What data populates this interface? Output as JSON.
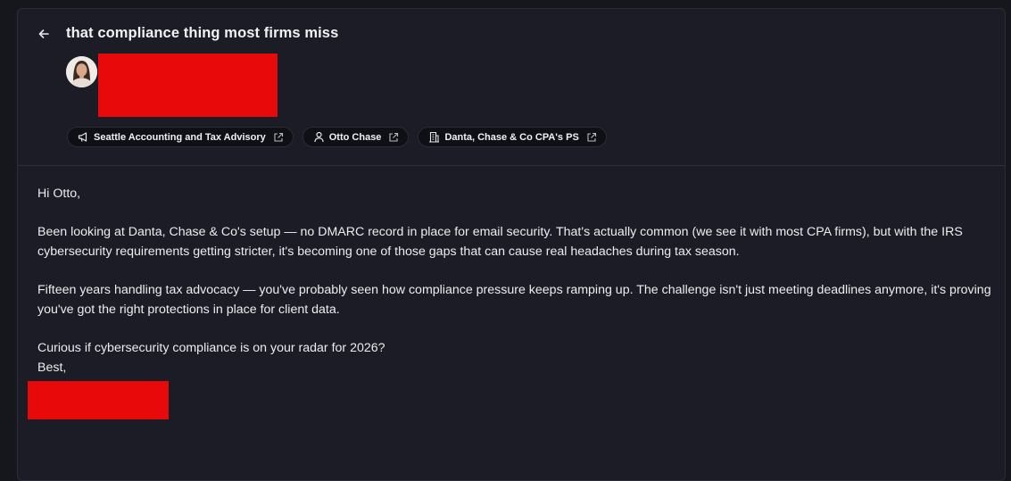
{
  "email": {
    "subject": "that compliance thing most firms miss",
    "sender_redacted": true,
    "chips": [
      {
        "icon": "megaphone-icon",
        "label": "Seattle Accounting and Tax Advisory"
      },
      {
        "icon": "person-icon",
        "label": "Otto Chase"
      },
      {
        "icon": "building-icon",
        "label": "Danta, Chase & Co CPA's PS"
      }
    ],
    "body": {
      "greeting": "Hi Otto,",
      "paragraph1": "Been looking at Danta, Chase & Co's setup — no DMARC record in place for email security. That's actually common (we see it with most CPA firms), but with the IRS cybersecurity requirements getting stricter, it's becoming one of those gaps that can cause real headaches during tax season.",
      "paragraph2": "Fifteen years handling tax advocacy — you've probably seen how compliance pressure keeps ramping up. The challenge isn't just meeting deadlines anymore, it's proving you've got the right protections in place for client data.",
      "question": "Curious if cybersecurity compliance is on your radar for 2026?",
      "signoff": "Best,"
    }
  },
  "colors": {
    "background": "#16161d",
    "panel": "#1b1c25",
    "chip_bg": "#0f1016",
    "redaction": "#e80a0a",
    "text": "#ededf0"
  }
}
